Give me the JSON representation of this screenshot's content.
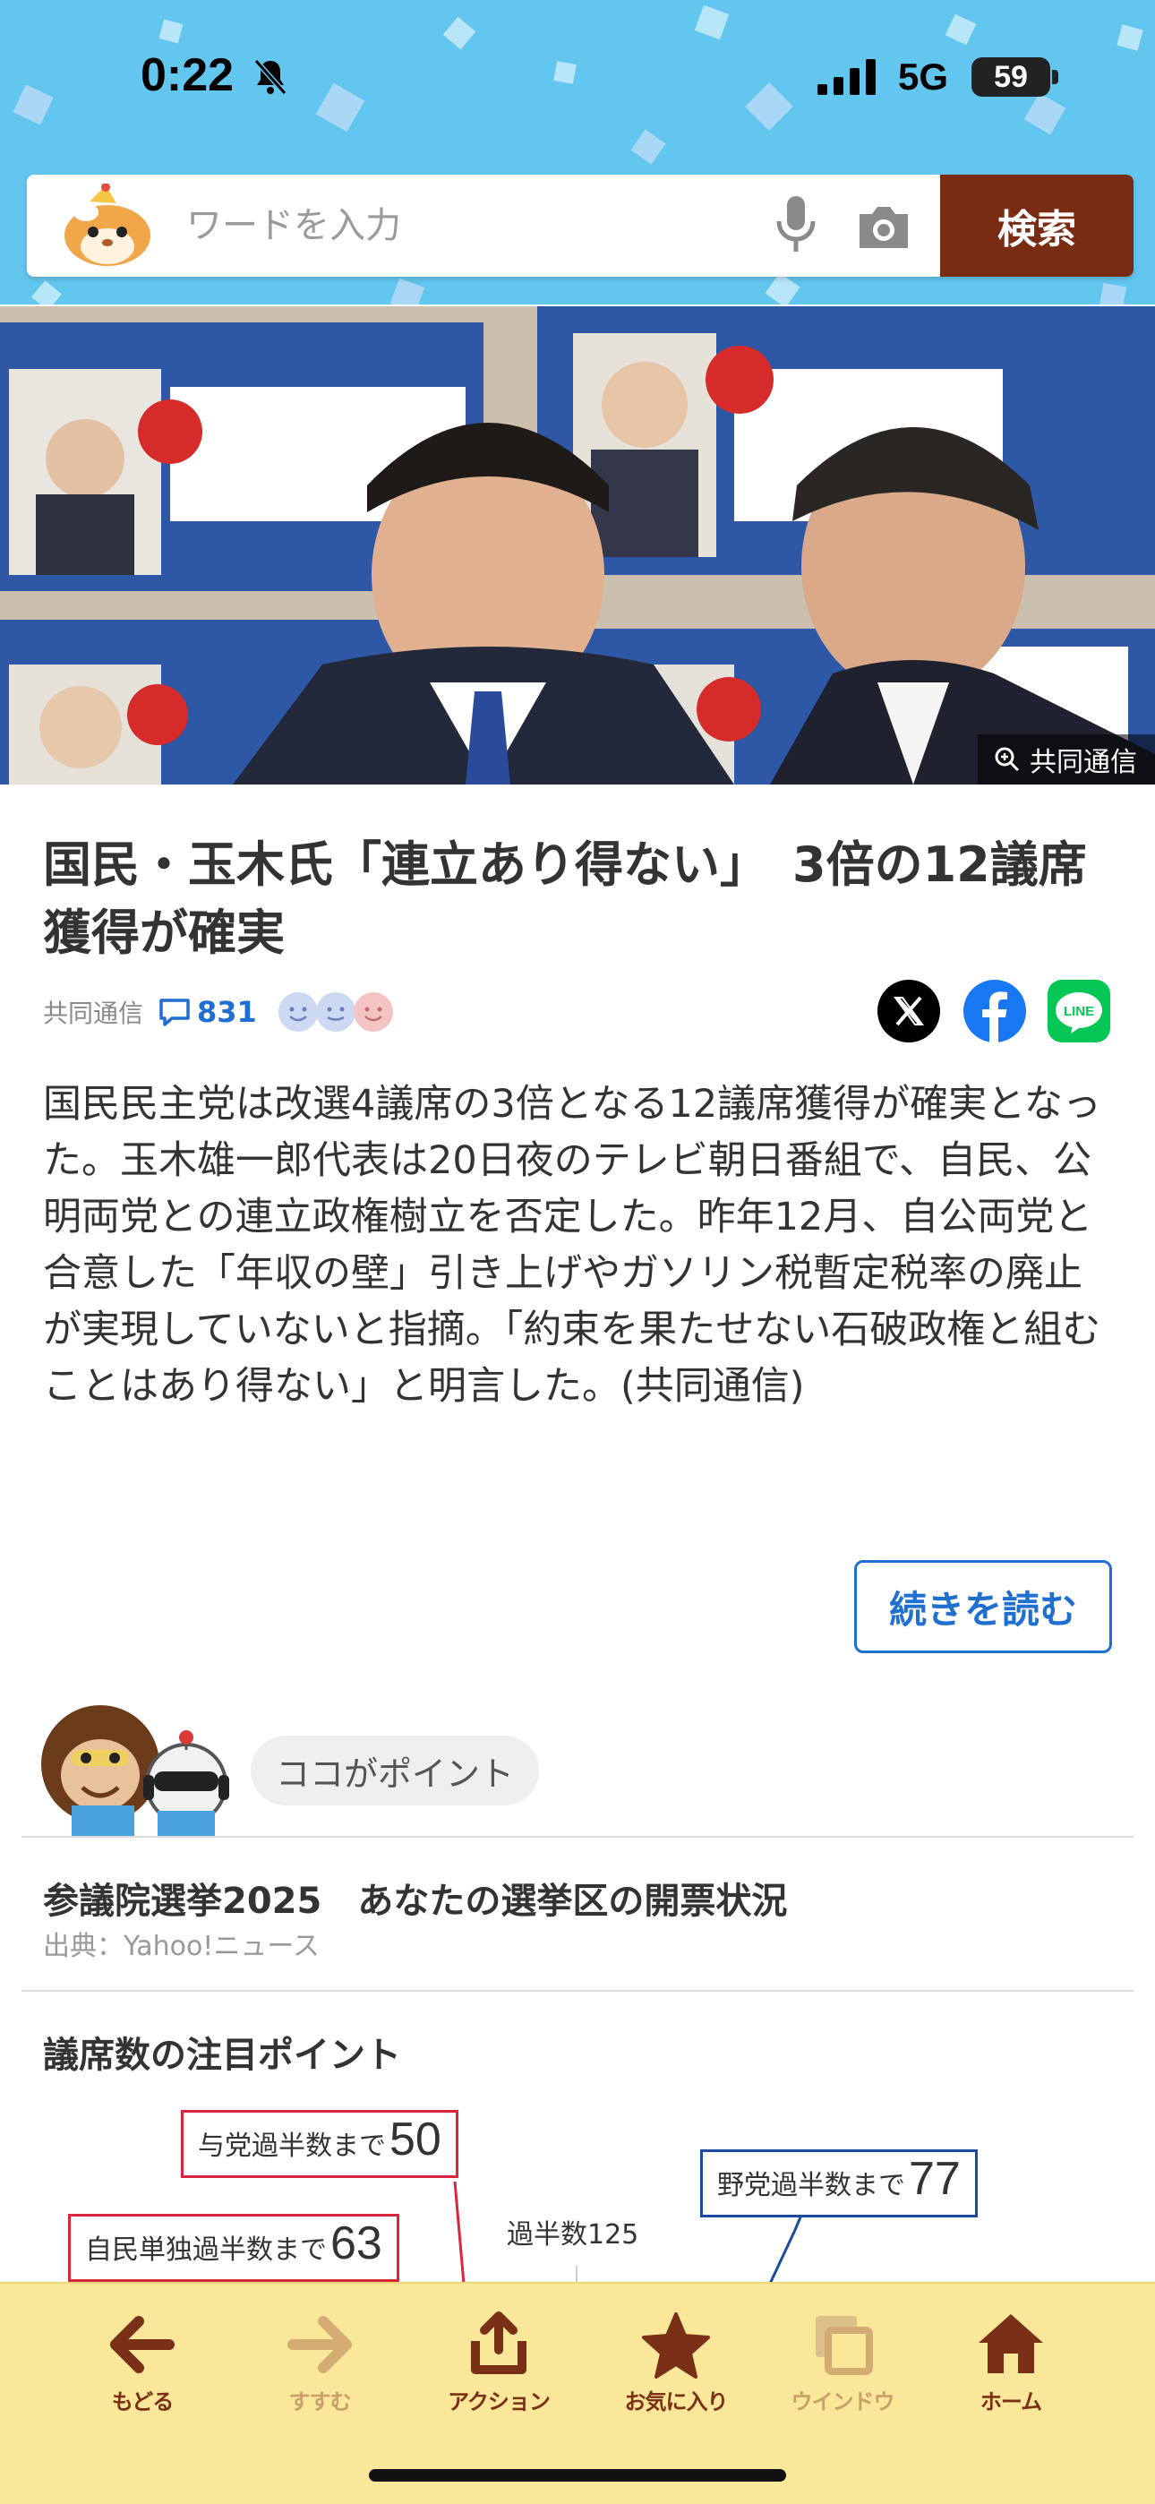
{
  "status_bar": {
    "time": "0:22",
    "network": "5G",
    "battery": "59"
  },
  "search": {
    "placeholder": "ワードを入力",
    "button_label": "検索"
  },
  "hero": {
    "credit": "共同通信"
  },
  "article": {
    "headline": "国民・玉木氏「連立あり得ない」　3倍の12議席獲得が確実",
    "source": "共同通信",
    "comment_count": "831",
    "body": "国民民主党は改選4議席の3倍となる12議席獲得が確実となった。玉木雄一郎代表は20日夜のテレビ朝日番組で、自民、公明両党との連立政権樹立を否定した。昨年12月、自公両党と合意した「年収の壁」引き上げやガソリン税暫定税率の廃止が実現していないと指摘。「約束を果たせない石破政権と組むことはあり得ない」と明言した。(共同通信)",
    "read_more": "続きを読む"
  },
  "share": {
    "x": "X",
    "facebook": "Facebook",
    "line": "LINE"
  },
  "point": {
    "badge": "ココがポイント",
    "link_title": "参議院選挙2025　あなたの選挙区の開票状況",
    "link_source": "出典：Yahoo!ニュース",
    "section_title": "議席数の注目ポイント",
    "infographic": {
      "ruling_label": "与党過半数まで",
      "ruling_value": "50",
      "ldp_label": "自民単独過半数まで",
      "ldp_value": "63",
      "majority_label": "過半数125",
      "opposition_label": "野党過半数まで",
      "opposition_value": "77"
    }
  },
  "toolbar": {
    "back": "もどる",
    "forward": "すすむ",
    "action": "アクション",
    "favorite": "お気に入り",
    "window": "ウインドウ",
    "home": "ホーム"
  },
  "colors": {
    "sky": "#62c6ef",
    "search_button": "#7a2c12",
    "link_blue": "#1f6fd1",
    "toolbar": "#fbe79a",
    "icon_brown": "#7a3016"
  }
}
